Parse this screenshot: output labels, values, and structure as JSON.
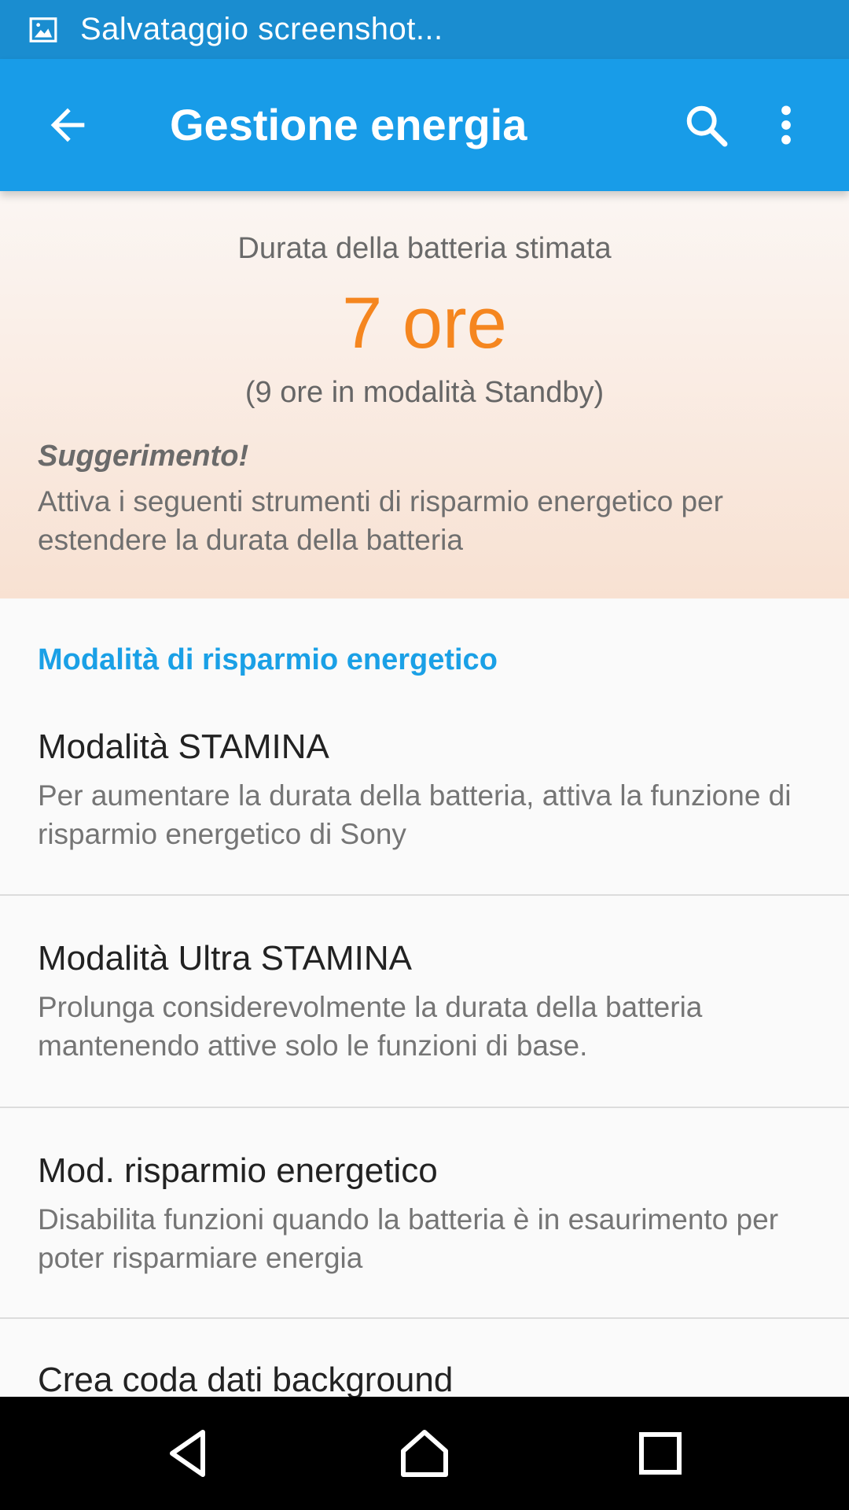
{
  "status_bar": {
    "icon": "image-icon",
    "text": "Salvataggio screenshot..."
  },
  "app_bar": {
    "back_icon": "arrow-back-icon",
    "title": "Gestione energia",
    "search_icon": "search-icon",
    "more_icon": "more-vert-icon"
  },
  "summary": {
    "estimate_label": "Durata della batteria stimata",
    "estimate_value": "7 ore",
    "standby": "(9 ore in modalità Standby)",
    "tip_title": "Suggerimento!",
    "tip_text": "Attiva i seguenti strumenti di risparmio energetico per estendere la durata della batteria"
  },
  "section_header": "Modalità di risparmio energetico",
  "items": [
    {
      "title": "Modalità STAMINA",
      "subtitle": "Per aumentare la durata della batteria, attiva la funzione di risparmio energetico di Sony"
    },
    {
      "title": "Modalità Ultra STAMINA",
      "subtitle": "Prolunga considerevolmente la durata della batteria mantenendo attive solo le funzioni di base."
    },
    {
      "title": "Mod. risparmio energetico",
      "subtitle": "Disabilita funzioni quando la batteria è in esaurimento per poter risparmiare energia"
    },
    {
      "title": "Crea coda dati background"
    }
  ],
  "nav_bar": {
    "back": "nav-back-icon",
    "home": "nav-home-icon",
    "recents": "nav-recents-icon"
  },
  "colors": {
    "status_bar": "#1a8dd0",
    "app_bar": "#189ce8",
    "accent_orange": "#f5861f",
    "section_blue": "#1aa0e6"
  }
}
